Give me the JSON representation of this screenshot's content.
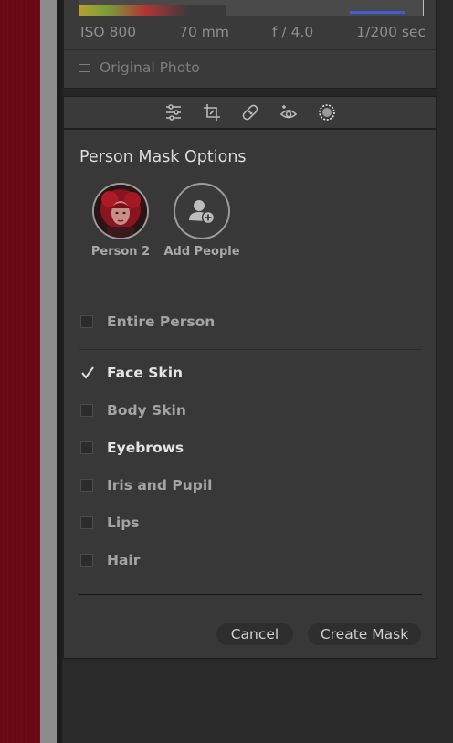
{
  "info": {
    "iso": "ISO 800",
    "focal": "70 mm",
    "aperture": "f / 4.0",
    "shutter": "1/200 sec",
    "original_photo_label": "Original Photo"
  },
  "toolbar": {
    "icons": [
      "sliders-icon",
      "crop-icon",
      "healing-icon",
      "redeye-icon",
      "masking-icon"
    ]
  },
  "mask": {
    "title": "Person Mask Options",
    "people": [
      {
        "label": "Person 2"
      },
      {
        "label": "Add People"
      }
    ],
    "entire_person": {
      "label": "Entire Person",
      "checked": false
    },
    "parts": [
      {
        "label": "Face Skin",
        "checked": true
      },
      {
        "label": "Body Skin",
        "checked": false
      },
      {
        "label": "Eyebrows",
        "checked": false
      },
      {
        "label": "Iris and Pupil",
        "checked": false
      },
      {
        "label": "Lips",
        "checked": false
      },
      {
        "label": "Hair",
        "checked": false
      }
    ],
    "cancel_label": "Cancel",
    "create_label": "Create Mask"
  }
}
